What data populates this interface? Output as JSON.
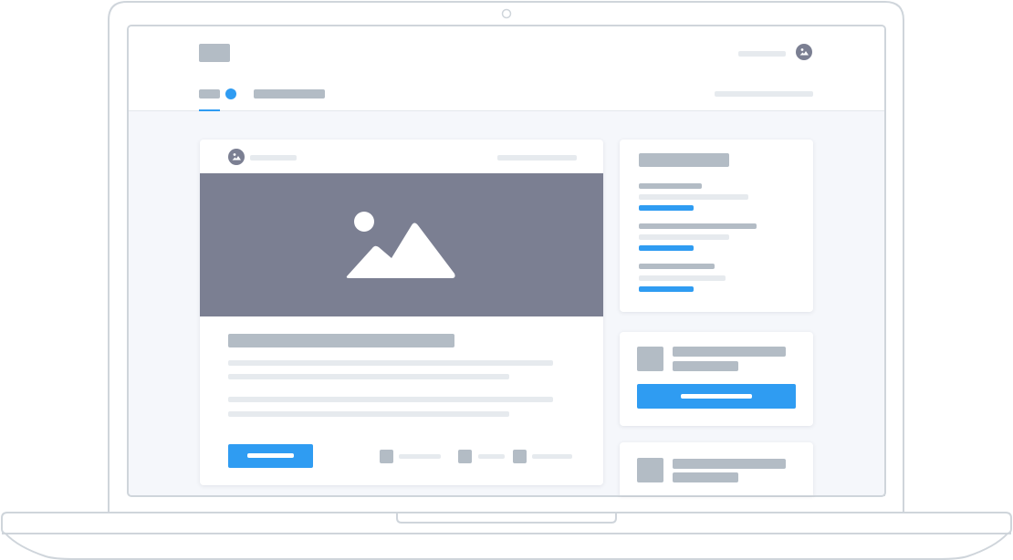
{
  "illustration": "laptop-wireframe-mockup",
  "header": {
    "logo_icon": "logo-placeholder",
    "profile_icon": "image-icon",
    "active_tab_indicator": "blue-dot"
  },
  "feed_card": {
    "author_icon": "image-icon",
    "media_icon": "mountain-image-icon",
    "media_color": "#7b7f92",
    "button_label": "",
    "action_icons": [
      "action-icon",
      "action-icon",
      "action-icon"
    ]
  },
  "side_cards": {
    "link_list_count": 3,
    "profile_cards": 2,
    "button_label": ""
  },
  "colors": {
    "accent": "#2f9cf2",
    "placeholder_dark": "#b3bcc5",
    "placeholder_light": "#e6eaee",
    "screen_background": "#f5f7fb",
    "device_outline": "#cfd5db"
  }
}
